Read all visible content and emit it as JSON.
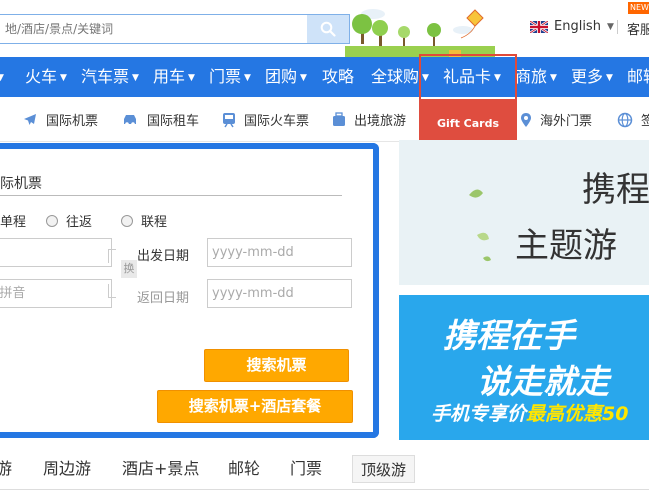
{
  "search": {
    "placeholder": "地/酒店/景点/关键词"
  },
  "header": {
    "language": "English",
    "service": "客服",
    "badge": "NEW"
  },
  "nav": {
    "items": [
      {
        "label": "",
        "caret": true
      },
      {
        "label": "火车",
        "caret": true
      },
      {
        "label": "汽车票",
        "caret": true
      },
      {
        "label": "用车",
        "caret": true
      },
      {
        "label": "门票",
        "caret": true
      },
      {
        "label": "团购",
        "caret": true
      },
      {
        "label": "攻略",
        "caret": false
      },
      {
        "label": "全球购",
        "caret": true
      },
      {
        "label": "礼品卡",
        "caret": true
      },
      {
        "label": "商旅",
        "caret": true
      },
      {
        "label": "更多",
        "caret": true
      },
      {
        "label": "邮轮",
        "caret": false
      }
    ],
    "dropdown_label": "Gift Cards"
  },
  "subnav": {
    "items": [
      {
        "label": "国际机票",
        "icon": "plane-icon"
      },
      {
        "label": "国际租车",
        "icon": "car-icon"
      },
      {
        "label": "国际火车票",
        "icon": "train-icon"
      },
      {
        "label": "出境旅游",
        "icon": "suitcase-icon"
      },
      {
        "label": "海外门票",
        "icon": "location-pin-icon"
      },
      {
        "label": "签",
        "icon": "globe-icon"
      }
    ]
  },
  "booking": {
    "title": "际机票",
    "trip_types": [
      "单程",
      "往返",
      "联程"
    ],
    "from_placeholder": "",
    "to_placeholder": "/拼音",
    "depart_label": "出发日期",
    "return_label": "返回日期",
    "date_placeholder": "yyyy-mm-dd",
    "swap_label": "换",
    "search_button": "搜索机票",
    "package_button": "搜索机票+酒店套餐"
  },
  "banners": {
    "top_line1": "携程",
    "top_line2": "主题游",
    "bottom_line1": "携程在手",
    "bottom_line2": "说走就走",
    "bottom_line3_prefix": "手机专享价",
    "bottom_line3_highlight": "最高优惠",
    "bottom_line3_suffix": "50"
  },
  "tabs": {
    "items": [
      "游",
      "周边游",
      "酒店+景点",
      "邮轮",
      "门票",
      "顶级游"
    ]
  },
  "colors": {
    "brand_blue": "#2577e3",
    "accent_orange": "#ffa800",
    "dropdown_red": "#df4d3f"
  }
}
